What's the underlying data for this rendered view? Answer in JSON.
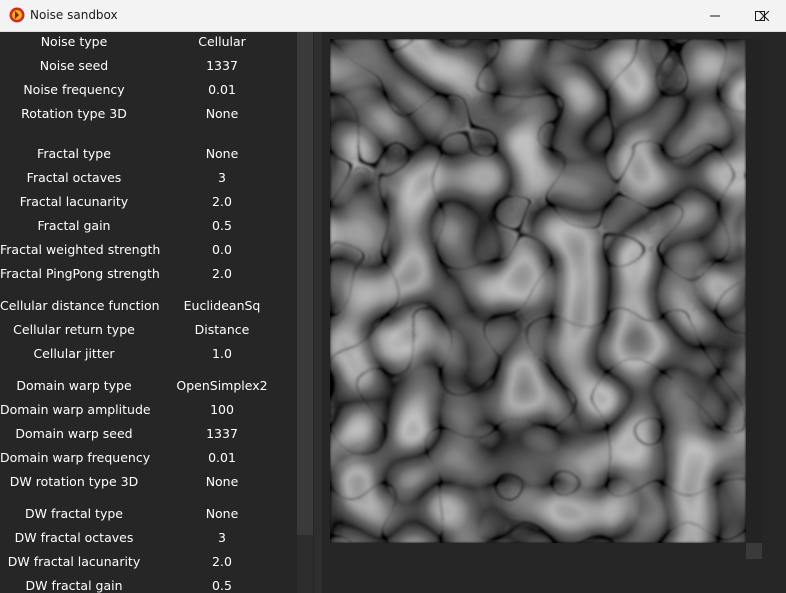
{
  "window": {
    "title": "Noise sandbox",
    "controls": {
      "minimize_icon": "minimize-icon",
      "maximize_icon": "maximize-icon",
      "close_icon": "close-icon"
    }
  },
  "properties": [
    {
      "label": "Noise type",
      "value": "Cellular"
    },
    {
      "label": "Noise seed",
      "value": "1337"
    },
    {
      "label": "Noise frequency",
      "value": "0.01"
    },
    {
      "label": "Rotation type 3D",
      "value": "None"
    },
    {
      "label": "Fractal type",
      "value": "None"
    },
    {
      "label": "Fractal octaves",
      "value": "3"
    },
    {
      "label": "Fractal lacunarity",
      "value": "2.0"
    },
    {
      "label": "Fractal gain",
      "value": "0.5"
    },
    {
      "label": "Fractal weighted strength",
      "value": "0.0"
    },
    {
      "label": "Fractal PingPong strength",
      "value": "2.0"
    },
    {
      "label": "Cellular distance function",
      "value": "EuclideanSq"
    },
    {
      "label": "Cellular return type",
      "value": "Distance"
    },
    {
      "label": "Cellular jitter",
      "value": "1.0"
    },
    {
      "label": "Domain warp type",
      "value": "OpenSimplex2"
    },
    {
      "label": "Domain warp amplitude",
      "value": "100"
    },
    {
      "label": "Domain warp seed",
      "value": "1337"
    },
    {
      "label": "Domain warp frequency",
      "value": "0.01"
    },
    {
      "label": "DW rotation type 3D",
      "value": "None"
    },
    {
      "label": "DW fractal type",
      "value": "None"
    },
    {
      "label": "DW fractal octaves",
      "value": "3"
    },
    {
      "label": "DW fractal lacunarity",
      "value": "2.0"
    },
    {
      "label": "DW fractal gain",
      "value": "0.5"
    }
  ],
  "colors": {
    "background": "#262626",
    "titlebar": "#f3f3f3",
    "text": "#ffffff",
    "app_icon": "#d42a1e"
  }
}
